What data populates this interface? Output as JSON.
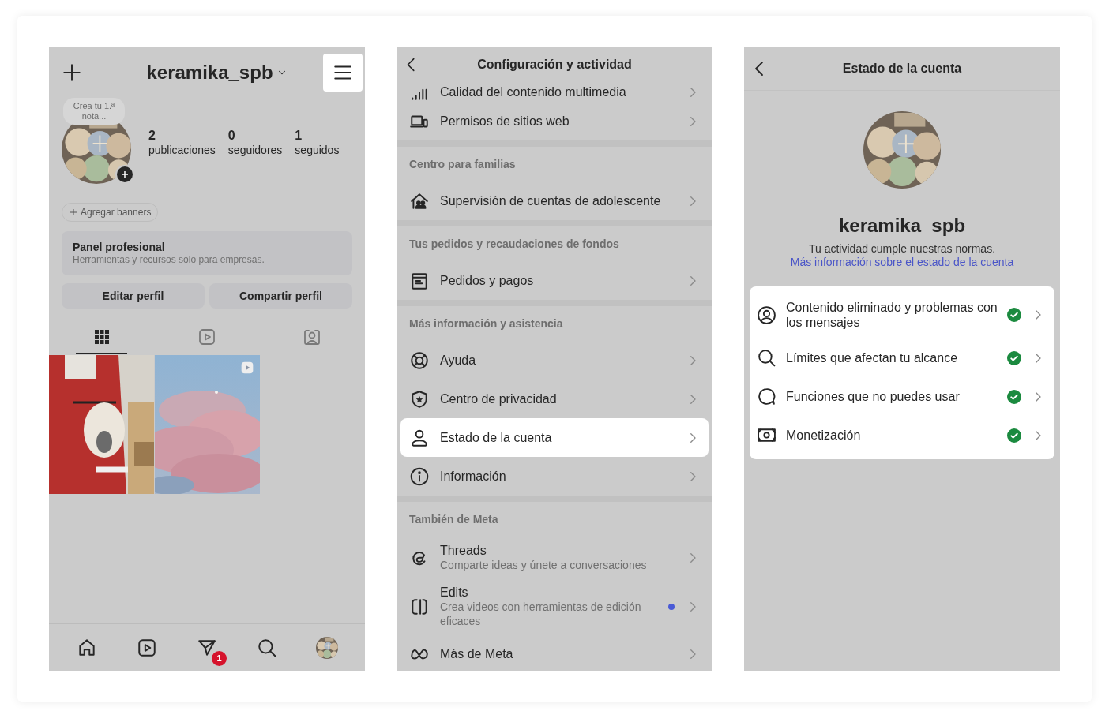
{
  "profile_screen": {
    "username": "keramika_spb",
    "menu_button": {
      "highlighted": true
    },
    "note_bubble": "Crea tu 1.ª nota...",
    "stats": [
      {
        "value": "2",
        "label": "publicaciones"
      },
      {
        "value": "0",
        "label": "seguidores"
      },
      {
        "value": "1",
        "label": "seguidos"
      }
    ],
    "banner_button": "Agregar banners",
    "professional_panel": {
      "title": "Panel profesional",
      "subtitle": "Herramientas y recursos solo para empresas."
    },
    "buttons": [
      "Editar perfil",
      "Compartir perfil"
    ],
    "tabs": [
      {
        "kind": "grid",
        "selected": true
      },
      {
        "kind": "reels",
        "selected": false
      },
      {
        "kind": "tagged",
        "selected": false
      }
    ],
    "posts": [
      {
        "kind": "picture",
        "video": false
      },
      {
        "kind": "picture",
        "video": true
      }
    ],
    "bottom_nav": [
      {
        "kind": "home"
      },
      {
        "kind": "reels"
      },
      {
        "kind": "messages",
        "badge": "1"
      },
      {
        "kind": "search"
      },
      {
        "kind": "avatar"
      }
    ]
  },
  "settings_screen": {
    "title": "Configuración y actividad",
    "sections": [
      {
        "items": [
          {
            "kind": "signal",
            "label": "Calidad del contenido multimedia",
            "highlighted": false,
            "new_dot": false
          },
          {
            "kind": "devices",
            "label": "Permisos de sitios web",
            "highlighted": false,
            "new_dot": false
          }
        ]
      },
      {
        "header": "Centro para familias",
        "items": [
          {
            "kind": "family",
            "label": "Supervisión de cuentas de adolescente",
            "highlighted": false,
            "new_dot": false
          }
        ]
      },
      {
        "header": "Tus pedidos y recaudaciones de fondos",
        "items": [
          {
            "kind": "orders",
            "label": "Pedidos y pagos",
            "highlighted": false,
            "new_dot": false
          }
        ]
      },
      {
        "header": "Más información y asistencia",
        "items": [
          {
            "kind": "help",
            "label": "Ayuda",
            "highlighted": false,
            "new_dot": false
          },
          {
            "kind": "privacy",
            "label": "Centro de privacidad",
            "highlighted": false,
            "new_dot": false
          },
          {
            "kind": "person",
            "label": "Estado de la cuenta",
            "highlighted": true,
            "new_dot": false
          },
          {
            "kind": "info",
            "label": "Información",
            "highlighted": false,
            "new_dot": false
          }
        ]
      },
      {
        "header": "También de Meta",
        "items": [
          {
            "kind": "threads",
            "label": "Threads",
            "subtitle": "Comparte ideas y únete a conversaciones",
            "highlighted": false,
            "new_dot": false
          },
          {
            "kind": "edits",
            "label": "Edits",
            "subtitle": "Crea videos con herramientas de edición eficaces",
            "highlighted": false,
            "new_dot": true
          },
          {
            "kind": "meta",
            "label": "Más de Meta",
            "highlighted": false,
            "new_dot": false
          }
        ]
      }
    ]
  },
  "account_status_screen": {
    "title": "Estado de la cuenta",
    "username": "keramika_spb",
    "status_text": "Tu actividad cumple nuestras normas.",
    "status_link": "Más información sobre el estado de la cuenta",
    "items": [
      {
        "kind": "person-circle",
        "label": "Contenido eliminado y problemas con los mensajes",
        "ok": true
      },
      {
        "kind": "search",
        "label": "Límites que afectan tu alcance",
        "ok": true
      },
      {
        "kind": "chat",
        "label": "Funciones que no puedes usar",
        "ok": true
      },
      {
        "kind": "money",
        "label": "Monetización",
        "ok": true
      }
    ]
  }
}
